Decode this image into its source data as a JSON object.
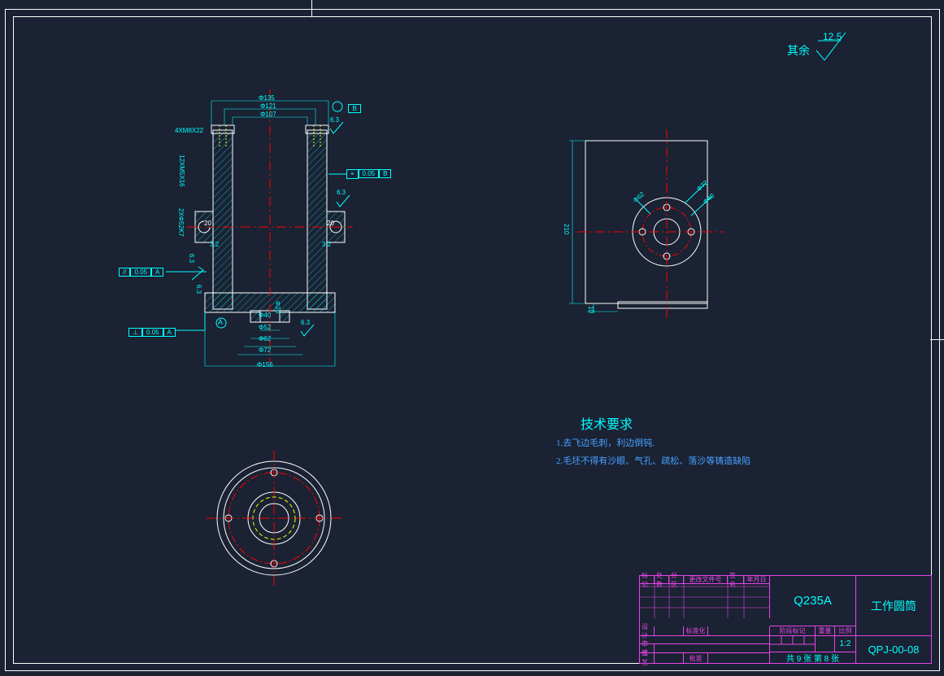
{
  "surface_note": {
    "prefix": "其余",
    "value": "12.5"
  },
  "section_view": {
    "dims_top": {
      "d135": "Φ135",
      "d121": "Φ121",
      "d107": "Φ107"
    },
    "dims_left": {
      "holes4": "4XM8X22",
      "holes12": "12XM5X16",
      "dia52": "2XΦ52K7"
    },
    "dims_bottom": {
      "d40": "Φ40",
      "d52": "Φ52",
      "d62": "Φ62",
      "d72": "Φ72",
      "d156": "Φ156",
      "d20h": "Φ20"
    },
    "notes": {
      "r63_1": "6.3",
      "r63_2": "6.3",
      "r63_3": "6.3",
      "r63_4": "6.3",
      "v20_1": "20",
      "v20_2": "20",
      "v32_1": "3.2",
      "v32_2": "3.2"
    },
    "fc_par": {
      "sym": "//",
      "tol": "0.05",
      "ref": "A"
    },
    "fc_perp": {
      "sym": "⊥",
      "tol": "0.05",
      "ref": "A"
    },
    "fc_pos": {
      "sym": "⌖",
      "tol": "0.05",
      "ref": "B"
    },
    "datum_a": "A",
    "datum_b": "B"
  },
  "side_view": {
    "h": "210",
    "w": "10",
    "d72": "Φ72",
    "d40": "Φ40",
    "d62": "Φ62"
  },
  "tech_req": {
    "title": "技术要求",
    "l1": "1.去飞边毛刺，利边倒钝.",
    "l2": "2.毛坯不得有沙眼、气孔、疏松、落沙等铸造缺陷"
  },
  "title_block": {
    "material": "Q235A",
    "part_name": "工作圆筒",
    "part_no": "QPJ-00-08",
    "sheet": "共 9 张 第 8 张",
    "scale": "1:2",
    "h": {
      "mark": "标记",
      "cnt": "处数",
      "zone": "分区",
      "doc": "更改文件号",
      "sig": "签名",
      "date": "年月日",
      "des": "设计",
      "std": "标准化",
      "chk": "审核",
      "appr": "批准",
      "proc": "工艺",
      "stage": "阶段标记",
      "wt": "重量",
      "sc": "比例"
    }
  }
}
